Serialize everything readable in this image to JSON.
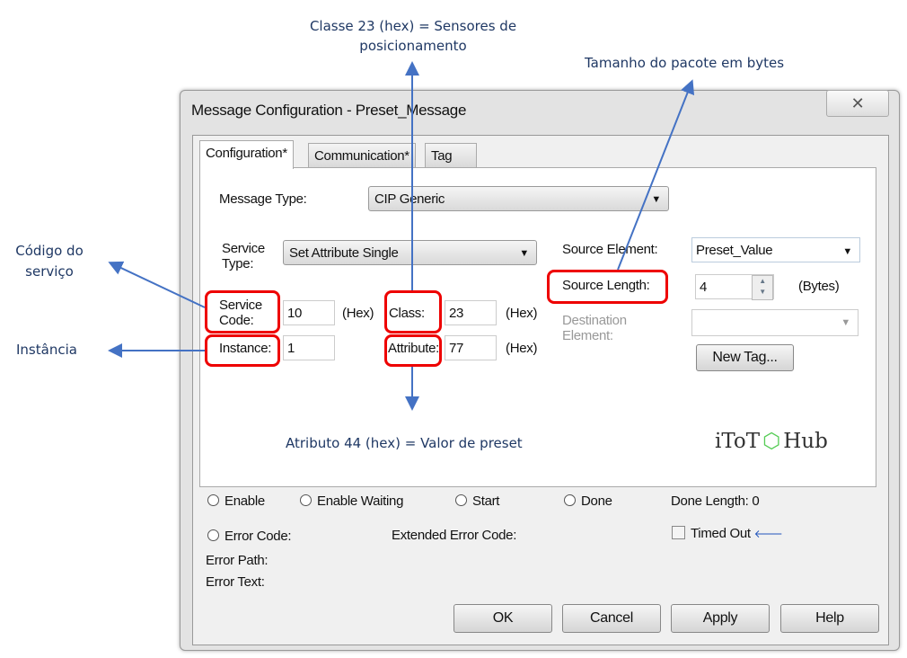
{
  "dialog": {
    "title": "Message Configuration - Preset_Message",
    "close_icon": "close-icon"
  },
  "tabs": [
    {
      "label": "Configuration*",
      "active": true
    },
    {
      "label": "Communication*"
    },
    {
      "label": "Tag"
    }
  ],
  "config": {
    "message_type_label": "Message Type:",
    "message_type_value": "CIP Generic",
    "service_type_label": "Service Type:",
    "service_type_label_1": "Service",
    "service_type_label_2": "Type:",
    "service_type_value": "Set Attribute Single",
    "service_code_label_1": "Service",
    "service_code_label_2": "Code:",
    "service_code_value": "10",
    "service_code_unit": "(Hex)",
    "class_label": "Class:",
    "class_value": "23",
    "class_unit": "(Hex)",
    "instance_label": "Instance:",
    "instance_value": "1",
    "attribute_label": "Attribute:",
    "attribute_value": "77",
    "attribute_unit": "(Hex)",
    "source_element_label": "Source Element:",
    "source_element_value": "Preset_Value",
    "source_length_label": "Source Length:",
    "source_length_value": "4",
    "source_length_unit": "(Bytes)",
    "destination_label_1": "Destination",
    "destination_label_2": "Element:",
    "destination_value": "",
    "new_tag_button": "New Tag..."
  },
  "logo": {
    "text_left": "iToT",
    "text_right": "Hub"
  },
  "status": {
    "enable": "Enable",
    "enable_waiting": "Enable Waiting",
    "start": "Start",
    "done": "Done",
    "done_length_label": "Done Length:",
    "done_length_value": "0",
    "error_code": "Error Code:",
    "extended_error_code": "Extended Error Code:",
    "timed_out": "Timed Out",
    "timed_out_checked": false,
    "error_path": "Error Path:",
    "error_text": "Error Text:"
  },
  "buttons": {
    "ok": "OK",
    "cancel": "Cancel",
    "apply": "Apply",
    "help": "Help"
  },
  "annotations": {
    "class_note_1": "Classe 23 (hex) = Sensores de",
    "class_note_2": "posicionamento",
    "length_note": "Tamanho do pacote em bytes",
    "service_note_1": "Código do",
    "service_note_2": "serviço",
    "instance_note": "Instância",
    "attribute_note": "Atributo 44 (hex) = Valor de preset",
    "arrow_color": "#4472C4",
    "highlight_color": "#E00000"
  }
}
